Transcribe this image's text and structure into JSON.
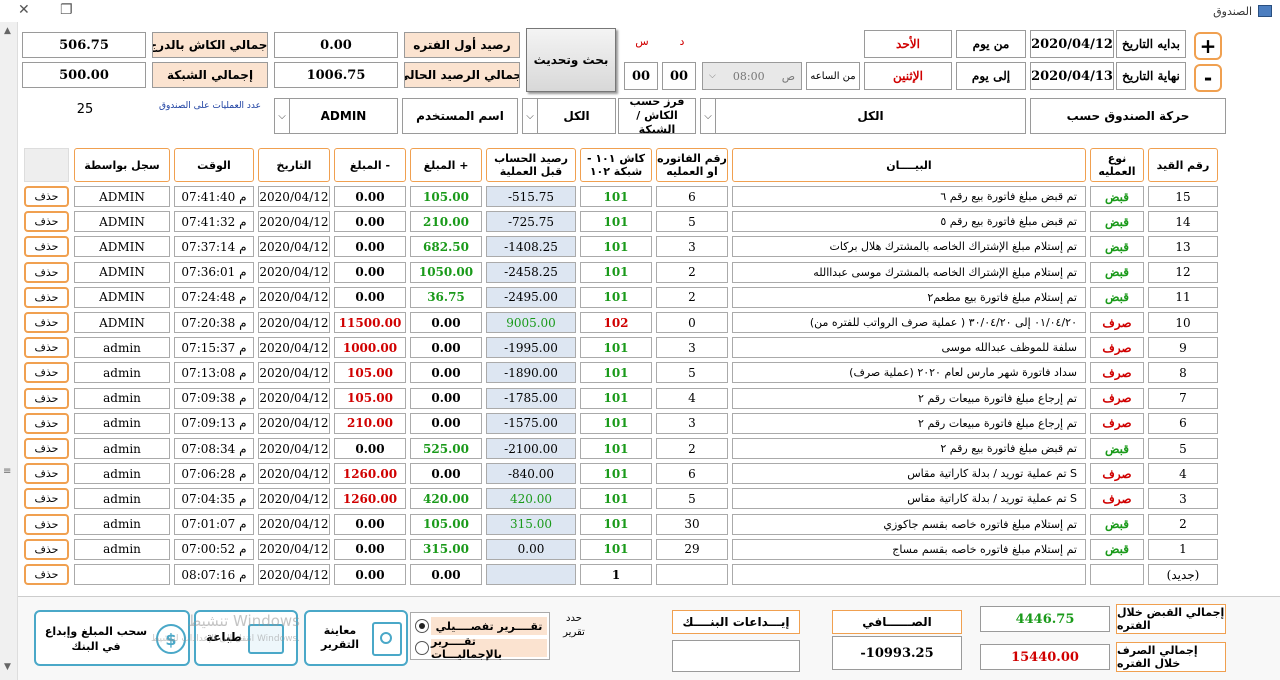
{
  "window": {
    "title": "الصندوق",
    "close": "✕",
    "restore": "❐"
  },
  "header": {
    "start_date_label": "بدايه التاريخ",
    "start_date": "2020/04/12",
    "from_day_label": "من يوم",
    "from_day": "الأحد",
    "end_date_label": "نهاية التاريخ",
    "end_date": "2020/04/13",
    "to_day_label": "إلى يوم",
    "to_day": "الإثنين",
    "from_hour_label": "من الساعه",
    "time_value": "08:00",
    "time_suffix": "ص",
    "hours": "00",
    "minutes": "00",
    "d_label": "د",
    "s_label": "س",
    "search_button": "بحث وتحديث",
    "opening_balance_label": "رصيد أول الفتره",
    "opening_balance": "0.00",
    "cash_drawer_label": "إجمالي الكاش بالدرج",
    "cash_drawer": "506.75",
    "current_balance_label": "إجمالي الرصيد الحالي",
    "current_balance": "1006.75",
    "network_label": "إجمالي الشبكة",
    "network": "500.00",
    "movement_by_label": "حركة الصندوق حسب",
    "movement_by": "الكل",
    "sort_label": "فرز حسب الكاش / الشبكة",
    "sort_value": "الكل",
    "username_label": "اسم المستخدم",
    "username": "ADMIN",
    "ops_count_label": "عدد العمليات على الصندوق",
    "ops_count": "25"
  },
  "table": {
    "headers": {
      "entry_no": "رقم القيد",
      "op_type": "نوع العمليه",
      "statement": "البيــــان",
      "invoice_no": "رقم الفاتوره او العمليه",
      "cash_network": "كاش ١٠١ - شبكة ١٠٢",
      "balance": "رصيد الحساب قبل العملية",
      "amount_plus": "المبلغ +",
      "amount_minus": "المبلغ -",
      "date": "التاريخ",
      "time": "الوقت",
      "recorded_by": "سجل بواسطة"
    },
    "delete_label": "حذف",
    "rows": [
      {
        "no": "15",
        "type": "قبض",
        "tc": "green",
        "desc": "تم قبض مبلغ فاتورة بيع رقم ٦",
        "inv": "6",
        "cn": "101",
        "cnc": "green",
        "bal": "-515.75",
        "plus": "105.00",
        "minus": "0.00",
        "date": "2020/04/12",
        "time": "07:41:40 م",
        "by": "ADMIN"
      },
      {
        "no": "14",
        "type": "قبض",
        "tc": "green",
        "desc": "تم قبض مبلغ فاتورة بيع رقم ٥",
        "inv": "5",
        "cn": "101",
        "cnc": "green",
        "bal": "-725.75",
        "plus": "210.00",
        "minus": "0.00",
        "date": "2020/04/12",
        "time": "07:41:32 م",
        "by": "ADMIN"
      },
      {
        "no": "13",
        "type": "قبض",
        "tc": "green",
        "desc": "تم إستلام مبلغ الإشتراك الخاصه بالمشترك هلال بركات",
        "inv": "3",
        "cn": "101",
        "cnc": "green",
        "bal": "-1408.25",
        "plus": "682.50",
        "minus": "0.00",
        "date": "2020/04/12",
        "time": "07:37:14 م",
        "by": "ADMIN"
      },
      {
        "no": "12",
        "type": "قبض",
        "tc": "green",
        "desc": "تم إستلام مبلغ الإشتراك الخاصه بالمشترك موسى عبداالله",
        "inv": "2",
        "cn": "101",
        "cnc": "green",
        "bal": "-2458.25",
        "plus": "1050.00",
        "minus": "0.00",
        "date": "2020/04/12",
        "time": "07:36:01 م",
        "by": "ADMIN"
      },
      {
        "no": "11",
        "type": "قبض",
        "tc": "green",
        "desc": "تم إستلام مبلغ فاتورة بيع مطعم٢",
        "inv": "2",
        "cn": "101",
        "cnc": "green",
        "bal": "-2495.00",
        "plus": "36.75",
        "minus": "0.00",
        "date": "2020/04/12",
        "time": "07:24:48 م",
        "by": "ADMIN"
      },
      {
        "no": "10",
        "type": "صرف",
        "tc": "red",
        "desc": "(عملية صرف الرواتب للفتره من ) ٠١/٠٤/٢٠ إلى ٣٠/٠٤/٢٠",
        "inv": "0",
        "cn": "102",
        "cnc": "red",
        "bal": "9005.00",
        "plus": "0.00",
        "minus": "11500.00",
        "date": "2020/04/12",
        "time": "07:20:38 م",
        "by": "ADMIN"
      },
      {
        "no": "9",
        "type": "صرف",
        "tc": "red",
        "desc": "سلفة للموظف عبدالله موسى",
        "inv": "3",
        "cn": "101",
        "cnc": "green",
        "bal": "-1995.00",
        "plus": "0.00",
        "minus": "1000.00",
        "date": "2020/04/12",
        "time": "07:15:37 م",
        "by": "admin"
      },
      {
        "no": "8",
        "type": "صرف",
        "tc": "red",
        "desc": "(عملية صرف) سداد فاتورة شهر مارس لعام ٢٠٢٠",
        "inv": "5",
        "cn": "101",
        "cnc": "green",
        "bal": "-1890.00",
        "plus": "0.00",
        "minus": "105.00",
        "date": "2020/04/12",
        "time": "07:13:08 م",
        "by": "admin"
      },
      {
        "no": "7",
        "type": "صرف",
        "tc": "red",
        "desc": "تم إرجاع مبلغ فاتورة مبيعات رقم ٢",
        "inv": "4",
        "cn": "101",
        "cnc": "green",
        "bal": "-1785.00",
        "plus": "0.00",
        "minus": "105.00",
        "date": "2020/04/12",
        "time": "07:09:38 م",
        "by": "admin"
      },
      {
        "no": "6",
        "type": "صرف",
        "tc": "red",
        "desc": "تم إرجاع مبلغ فاتورة مبيعات رقم ٢",
        "inv": "3",
        "cn": "101",
        "cnc": "green",
        "bal": "-1575.00",
        "plus": "0.00",
        "minus": "210.00",
        "date": "2020/04/12",
        "time": "07:09:13 م",
        "by": "admin"
      },
      {
        "no": "5",
        "type": "قبض",
        "tc": "green",
        "desc": "تم قبض مبلغ فاتورة بيع رقم ٢",
        "inv": "2",
        "cn": "101",
        "cnc": "green",
        "bal": "-2100.00",
        "plus": "525.00",
        "minus": "0.00",
        "date": "2020/04/12",
        "time": "07:08:34 م",
        "by": "admin"
      },
      {
        "no": "4",
        "type": "صرف",
        "tc": "red",
        "desc": "تم عملية توريد / بدلة كاراتية مقاس S",
        "inv": "6",
        "cn": "101",
        "cnc": "green",
        "bal": "-840.00",
        "plus": "0.00",
        "minus": "1260.00",
        "date": "2020/04/12",
        "time": "07:06:28 م",
        "by": "admin"
      },
      {
        "no": "3",
        "type": "صرف",
        "tc": "red",
        "desc": "تم عملية توريد / بدلة كاراتية مقاس S",
        "inv": "5",
        "cn": "101",
        "cnc": "green",
        "bal": "420.00",
        "plus": "420.00",
        "minus": "1260.00",
        "date": "2020/04/12",
        "time": "07:04:35 م",
        "by": "admin"
      },
      {
        "no": "2",
        "type": "قبض",
        "tc": "green",
        "desc": "تم إستلام مبلغ فاتوره خاصه بقسم جاكوزي",
        "inv": "30",
        "cn": "101",
        "cnc": "green",
        "bal": "315.00",
        "plus": "105.00",
        "minus": "0.00",
        "date": "2020/04/12",
        "time": "07:01:07 م",
        "by": "admin"
      },
      {
        "no": "1",
        "type": "قبض",
        "tc": "green",
        "desc": "تم إستلام مبلغ فاتوره خاصه بقسم مساج",
        "inv": "29",
        "cn": "101",
        "cnc": "green",
        "bal": "0.00",
        "plus": "315.00",
        "minus": "0.00",
        "date": "2020/04/12",
        "time": "07:00:52 م",
        "by": "admin"
      },
      {
        "no": "(جديد)",
        "type": "",
        "tc": "green",
        "desc": "",
        "inv": "",
        "cn": "1",
        "cnc": "black",
        "bal": "",
        "plus": "0.00",
        "minus": "0.00",
        "date": "2020/04/12",
        "time": "08:07:16 م",
        "by": ""
      }
    ]
  },
  "footer": {
    "total_receipts_label": "إجمالي القبض خلال الفتره",
    "total_receipts": "4446.75",
    "total_expenses_label": "إجمالي الصرف خلال الفتره",
    "total_expenses": "15440.00",
    "net_label": "الصــــــافي",
    "net": "-10993.25",
    "bank_deposits_label": "إيـــداعات البنــــك",
    "bank_deposits": "",
    "report_type_label": "حدد تقرير",
    "detailed_report": "تقــــرير تفصــــيلي",
    "totals_report": "تقــــرير بالإجماليـــات",
    "preview_label": "معاينة التقرير",
    "print_label": "طباعة",
    "withdraw_label": "سحب المبلغ وإبداع في البنك",
    "watermark_line1": "تنشيط Windows",
    "watermark_line2": "انتقل إلى الإعدادات لتنشيط Windows."
  },
  "colors": {
    "accent_orange": "#f0a050",
    "label_bg": "#fbe3d0",
    "balance_bg": "#dde6f2",
    "panel_blue": "#4aa8c8",
    "credit_green": "#1a9a1a",
    "debit_red": "#d00000"
  }
}
